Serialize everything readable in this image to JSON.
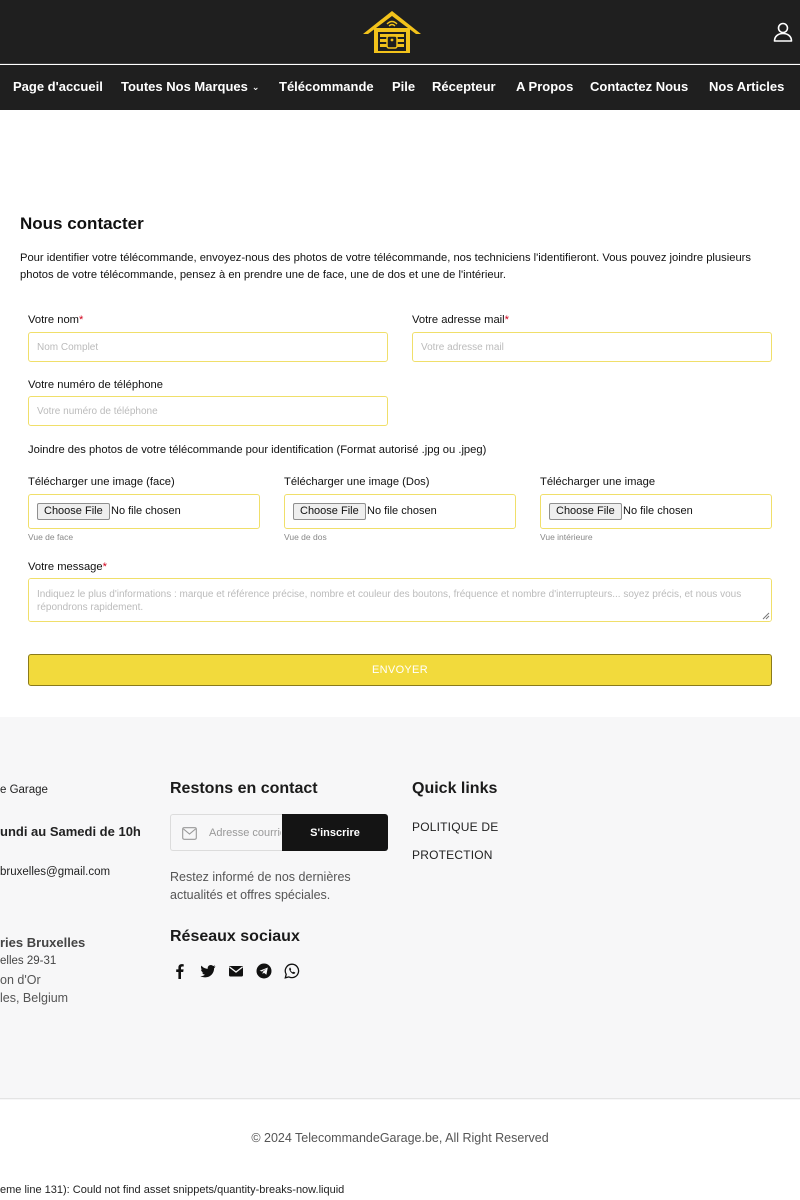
{
  "header": {
    "logo_icon": "garage-house-logo-icon",
    "account_icon": "user-account-icon",
    "colors": {
      "bar": "#1f1f1f",
      "logo": "#f2c21b"
    }
  },
  "nav": {
    "items": [
      {
        "label": "Page d'accueil"
      },
      {
        "label": "Toutes Nos Marques",
        "has_dropdown": true
      },
      {
        "label": "Télécommande"
      },
      {
        "label": "Pile"
      },
      {
        "label": "Récepteur"
      },
      {
        "label": "A Propos"
      },
      {
        "label": "Contactez Nous"
      },
      {
        "label": "Nos Articles"
      }
    ],
    "dropdown_glyph": "⌄"
  },
  "contact": {
    "title": "Nous contacter",
    "intro": "Pour identifier votre télécommande, envoyez-nous des photos de votre télécommande, nos techniciens l'identifieront. Vous pouvez joindre plusieurs photos de votre télécommande, pensez à en prendre une de face, une de dos et une de l'intérieur.",
    "required_mark": "*",
    "name": {
      "label": "Votre nom",
      "placeholder": "Nom Complet",
      "value": ""
    },
    "email": {
      "label": "Votre adresse mail",
      "placeholder": "Votre adresse mail",
      "value": ""
    },
    "phone": {
      "label": "Votre numéro de téléphone",
      "placeholder": "Votre numéro de téléphone",
      "value": ""
    },
    "photos_note": "Joindre des photos de votre télécommande pour identification (Format autorisé .jpg ou .jpeg)",
    "uploads": [
      {
        "label": "Télécharger une image (face)",
        "button": "Choose File",
        "status": "No file chosen",
        "hint": "Vue de face"
      },
      {
        "label": "Télécharger une image (Dos)",
        "button": "Choose File",
        "status": "No file chosen",
        "hint": "Vue de dos"
      },
      {
        "label": "Télécharger une image",
        "button": "Choose File",
        "status": "No file chosen",
        "hint": "Vue intérieure"
      }
    ],
    "message": {
      "label": "Votre message",
      "placeholder": "Indiquez le plus d'informations : marque et référence précise, nombre et couleur des boutons, fréquence et nombre d'interrupteurs... soyez précis, et nous vous répondrons rapidement.",
      "value": ""
    },
    "submit_label": "ENVOYER",
    "colors": {
      "field_border": "#f0df6a",
      "submit_bg": "#f2da3c",
      "required": "#d0021b"
    }
  },
  "footer": {
    "info": {
      "line1": "e Garage",
      "hours": "undi au Samedi de 10h",
      "email": "bruxelles@gmail.com",
      "store_name": "ries Bruxelles",
      "street": "elles 29-31",
      "area": "on d'Or",
      "city": "les, Belgium"
    },
    "newsletter": {
      "title": "Restons en contact",
      "placeholder": "Adresse courriel",
      "button": "S'inscrire",
      "note": "Restez informé de nos dernières actualités et offres spéciales."
    },
    "social": {
      "title": "Réseaux sociaux",
      "icons": [
        "facebook-icon",
        "twitter-icon",
        "email-icon",
        "telegram-icon",
        "whatsapp-icon"
      ]
    },
    "quick_links": {
      "title": "Quick links",
      "items": [
        "POLITIQUE DE",
        "PROTECTION"
      ]
    },
    "copyright": "© 2024 TelecommandeGarage.be, All Right Reserved"
  },
  "error_text": "eme line 131): Could not find asset snippets/quantity-breaks-now.liquid"
}
